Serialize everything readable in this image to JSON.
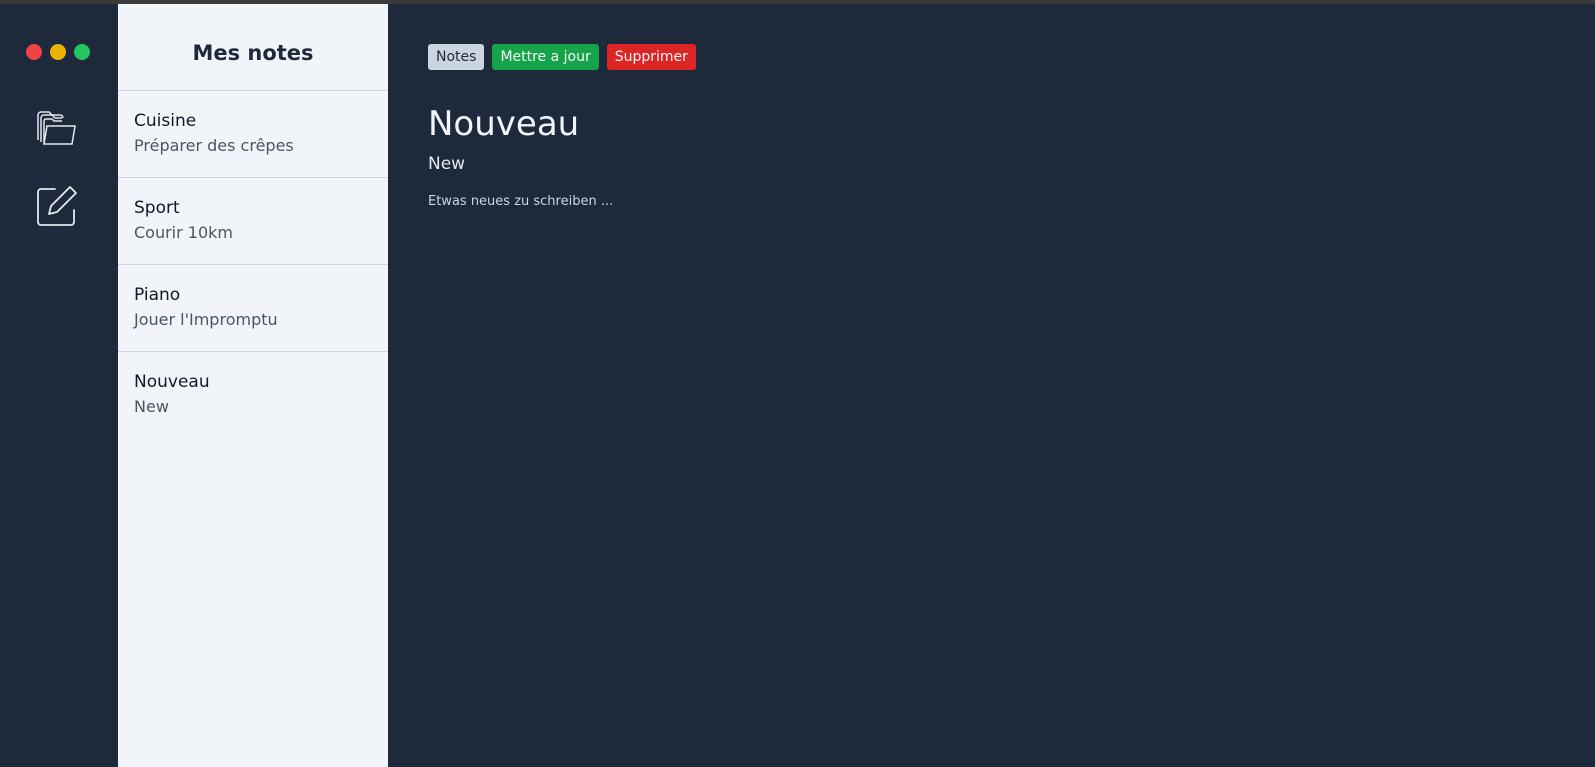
{
  "window_controls": {
    "close_color": "#ef4444",
    "minimize_color": "#eab308",
    "maximize_color": "#22c55e"
  },
  "sidebar": {
    "icons": [
      "folders-icon",
      "edit-icon"
    ]
  },
  "list": {
    "title": "Mes notes",
    "items": [
      {
        "title": "Cuisine",
        "subtitle": "Préparer des crêpes"
      },
      {
        "title": "Sport",
        "subtitle": "Courir 10km"
      },
      {
        "title": "Piano",
        "subtitle": "Jouer l'Impromptu"
      },
      {
        "title": "Nouveau",
        "subtitle": "New"
      }
    ]
  },
  "toolbar": {
    "notes_label": "Notes",
    "update_label": "Mettre a jour",
    "delete_label": "Supprimer",
    "colors": {
      "notes": "#cbd5e1",
      "update": "#16a34a",
      "delete": "#dc2626"
    }
  },
  "note": {
    "title": "Nouveau",
    "subtitle": "New",
    "content": "Etwas neues zu schreiben ..."
  }
}
